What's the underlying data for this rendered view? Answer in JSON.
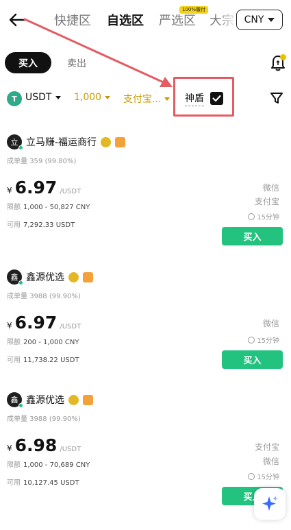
{
  "header": {
    "tabs": [
      {
        "label": "快捷区",
        "active": false
      },
      {
        "label": "自选区",
        "active": true
      },
      {
        "label": "严选区",
        "active": false,
        "badge": "100%履付"
      },
      {
        "label": "大宗",
        "active": false
      }
    ],
    "currency": "CNY"
  },
  "trade_tabs": {
    "buy": "买入",
    "sell": "卖出"
  },
  "filters": {
    "coin": "USDT",
    "amount": "1,000",
    "payment": "支付宝...",
    "shield_label": "神盾",
    "shield_checked": true
  },
  "listings": [
    {
      "merchant": "立马赚-福运商行",
      "avatar_char": "立",
      "stats_label": "成单量",
      "stats_value": "359 (99.80%)",
      "currency_symbol": "¥",
      "price": "6.97",
      "unit": "/USDT",
      "limit_label": "限额",
      "limit_value": "1,000 - 50,827 CNY",
      "avail_label": "可用",
      "avail_value": "7,292.33 USDT",
      "payment_methods": [
        "微信",
        "支付宝"
      ],
      "time": "15分钟",
      "buy_label": "买入"
    },
    {
      "merchant": "鑫源优选",
      "avatar_char": "鑫",
      "stats_label": "成单量",
      "stats_value": "3988 (99.90%)",
      "currency_symbol": "¥",
      "price": "6.97",
      "unit": "/USDT",
      "limit_label": "限额",
      "limit_value": "200 - 1,000 CNY",
      "avail_label": "可用",
      "avail_value": "11,738.22 USDT",
      "payment_methods": [
        "微信"
      ],
      "time": "15分钟",
      "buy_label": "买入"
    },
    {
      "merchant": "鑫源优选",
      "avatar_char": "鑫",
      "stats_label": "成单量",
      "stats_value": "3988 (99.90%)",
      "currency_symbol": "¥",
      "price": "6.98",
      "unit": "/USDT",
      "limit_label": "限额",
      "limit_value": "1,000 - 70,689 CNY",
      "avail_label": "可用",
      "avail_value": "10,127.45 USDT",
      "payment_methods": [
        "支付宝",
        "微信"
      ],
      "time": "15分钟",
      "buy_label": "买入"
    }
  ],
  "colors": {
    "accent_green": "#23c27f",
    "highlight_red": "#e55b63",
    "filter_gold": "#c89a00"
  }
}
